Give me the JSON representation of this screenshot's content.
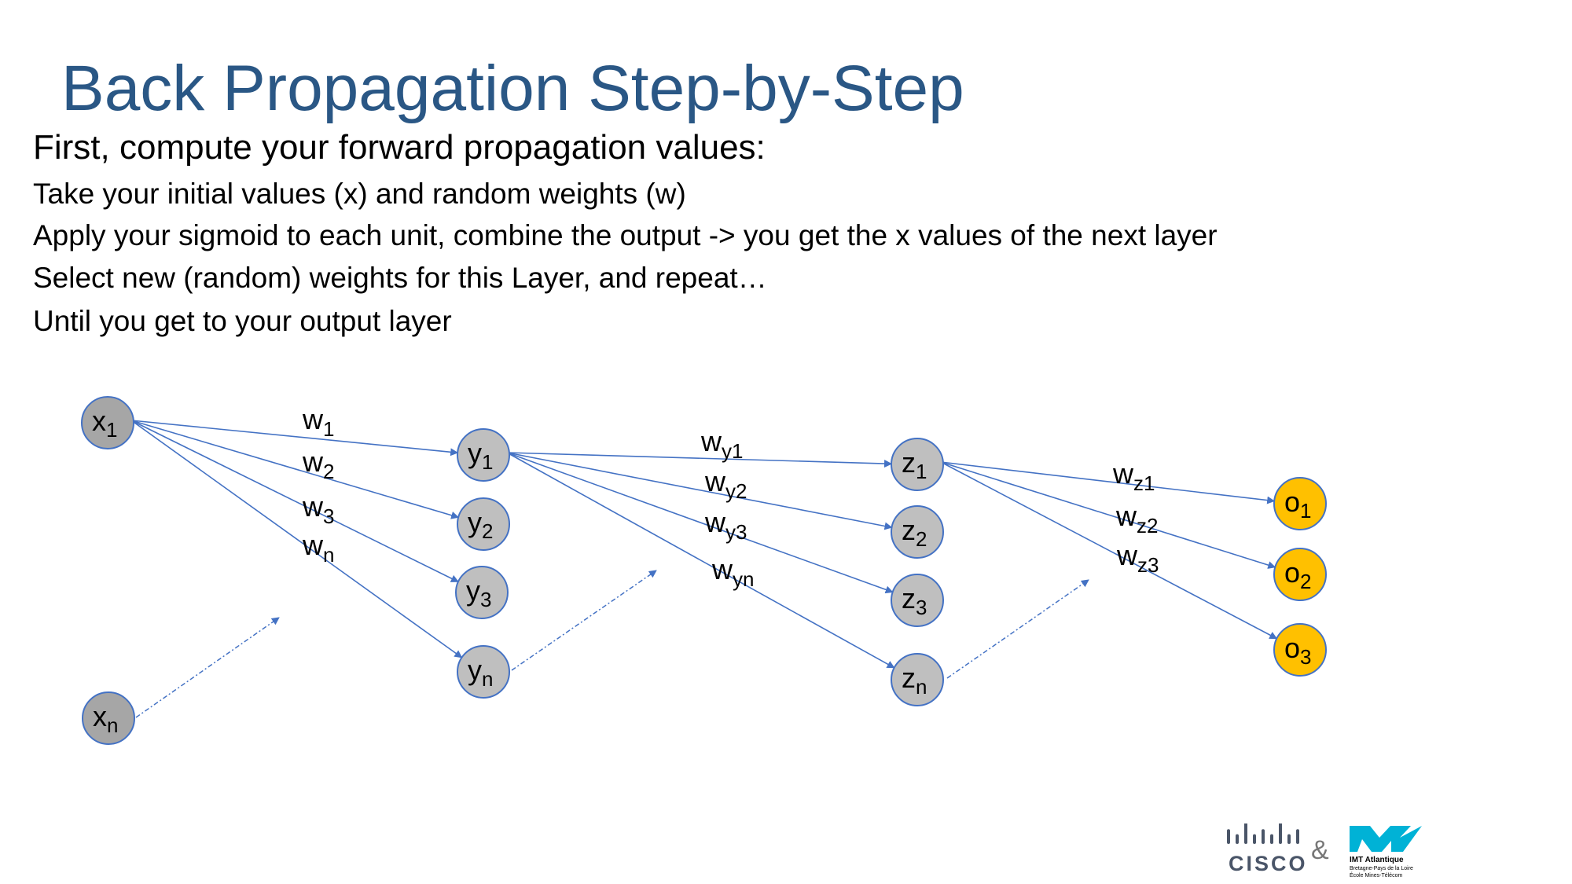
{
  "title": "Back Propagation Step-by-Step",
  "subtitle": "First, compute your forward propagation values:",
  "lines": [
    "Take your initial values (x) and random weights (w)",
    "Apply your sigmoid to each unit, combine the output -> you get the x values of the next layer",
    "Select new (random) weights for this Layer, and repeat…",
    "Until you get to your output layer"
  ],
  "diagram": {
    "nodes": [
      {
        "id": "x1",
        "base": "x",
        "sub": "1",
        "color": "#a6a6a6"
      },
      {
        "id": "xn",
        "base": "x",
        "sub": "n",
        "color": "#a6a6a6"
      },
      {
        "id": "y1",
        "base": "y",
        "sub": "1",
        "color": "#bfbfbf"
      },
      {
        "id": "y2",
        "base": "y",
        "sub": "2",
        "color": "#bfbfbf"
      },
      {
        "id": "y3",
        "base": "y",
        "sub": "3",
        "color": "#bfbfbf"
      },
      {
        "id": "yn",
        "base": "y",
        "sub": "n",
        "color": "#bfbfbf"
      },
      {
        "id": "z1",
        "base": "z",
        "sub": "1",
        "color": "#bfbfbf"
      },
      {
        "id": "z2",
        "base": "z",
        "sub": "2",
        "color": "#bfbfbf"
      },
      {
        "id": "z3",
        "base": "z",
        "sub": "3",
        "color": "#bfbfbf"
      },
      {
        "id": "zn",
        "base": "z",
        "sub": "n",
        "color": "#bfbfbf"
      },
      {
        "id": "o1",
        "base": "o",
        "sub": "1",
        "color": "#ffc000"
      },
      {
        "id": "o2",
        "base": "o",
        "sub": "2",
        "color": "#ffc000"
      },
      {
        "id": "o3",
        "base": "o",
        "sub": "3",
        "color": "#ffc000"
      }
    ],
    "edges": [
      {
        "from": "x1",
        "to": "y1"
      },
      {
        "from": "x1",
        "to": "y2"
      },
      {
        "from": "x1",
        "to": "y3"
      },
      {
        "from": "x1",
        "to": "yn"
      },
      {
        "from": "y1",
        "to": "z1"
      },
      {
        "from": "y1",
        "to": "z2"
      },
      {
        "from": "y1",
        "to": "z3"
      },
      {
        "from": "y1",
        "to": "zn"
      },
      {
        "from": "z1",
        "to": "o1"
      },
      {
        "from": "z1",
        "to": "o2"
      },
      {
        "from": "z1",
        "to": "o3"
      }
    ],
    "dotted_from": [
      "xn",
      "yn",
      "zn"
    ],
    "weights": [
      {
        "base": "w",
        "sub": "1"
      },
      {
        "base": "w",
        "sub": "2"
      },
      {
        "base": "w",
        "sub": "3"
      },
      {
        "base": "w",
        "sub": "n"
      },
      {
        "base": "w",
        "sub": "y1"
      },
      {
        "base": "w",
        "sub": "y2"
      },
      {
        "base": "w",
        "sub": "y3"
      },
      {
        "base": "w",
        "sub": "yn"
      },
      {
        "base": "w",
        "sub": "z1"
      },
      {
        "base": "w",
        "sub": "z2"
      },
      {
        "base": "w",
        "sub": "z3"
      }
    ],
    "edge_color": "#4472c4",
    "node_stroke": "#4472c4"
  },
  "logos": {
    "cisco": "CISCO",
    "ampersand": "&",
    "imt_name": "IMT Atlantique",
    "imt_line2": "Bretagne-Pays de la Loire",
    "imt_line3": "École Mines-Télécom",
    "cisco_color": "#4a5568",
    "imt_color": "#00b2d6"
  }
}
